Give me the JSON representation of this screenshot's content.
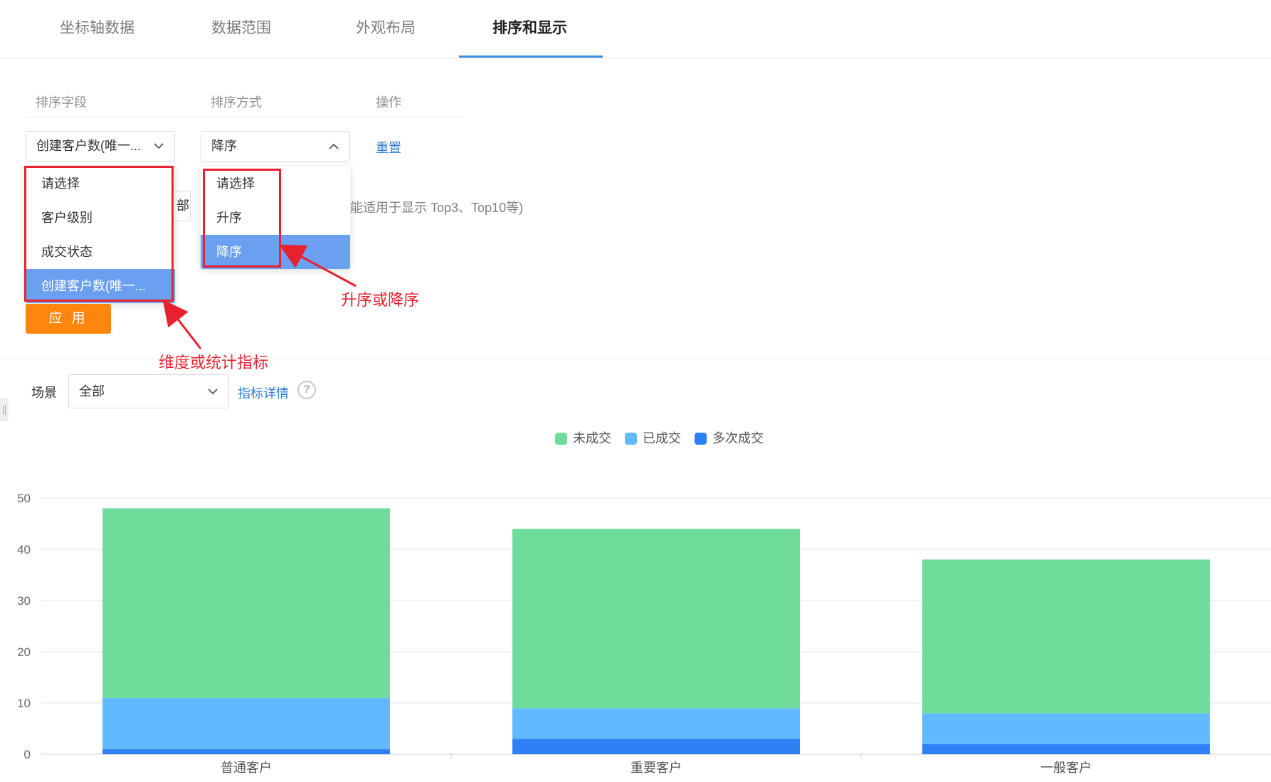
{
  "tabs": [
    {
      "label": "坐标轴数据"
    },
    {
      "label": "数据范围"
    },
    {
      "label": "外观布局"
    },
    {
      "label": "排序和显示"
    }
  ],
  "sort": {
    "header": {
      "field": "排序字段",
      "method": "排序方式",
      "action": "操作"
    },
    "field_value": "创建客户数(唯一...",
    "method_value": "降序",
    "reset_label": "重置"
  },
  "hidden_row": {
    "input_fragment": "部",
    "hint_fragment": "能适用于显示 Top3、Top10等)"
  },
  "field_menu": {
    "options": [
      "请选择",
      "客户级别",
      "成交状态",
      "创建客户数(唯一..."
    ],
    "selected_index": 3
  },
  "method_menu": {
    "options": [
      "请选择",
      "升序",
      "降序"
    ],
    "selected_index": 2
  },
  "annotations": {
    "field": "维度或统计指标",
    "method": "升序或降序"
  },
  "apply_label": "应 用",
  "scene": {
    "label": "场景",
    "value": "全部",
    "detail_link": "指标详情",
    "help": "?"
  },
  "colors": {
    "accent": "#3a8ee6",
    "apply": "#ff860d",
    "annotation": "#e8212e",
    "menu_selected": "#6b9ff0"
  },
  "chart_data": {
    "type": "bar",
    "stacked": true,
    "categories": [
      "普通客户",
      "重要客户",
      "一般客户"
    ],
    "series": [
      {
        "name": "多次成交",
        "color": "#2f7ff5",
        "values": [
          1,
          3,
          2
        ]
      },
      {
        "name": "已成交",
        "color": "#61b9ff",
        "values": [
          10,
          6,
          6
        ]
      },
      {
        "name": "未成交",
        "color": "#70dc9c",
        "values": [
          37,
          35,
          30
        ]
      }
    ],
    "legend_order": [
      "未成交",
      "已成交",
      "多次成交"
    ],
    "yticks": [
      0,
      10,
      20,
      30,
      40,
      50
    ],
    "ylim": [
      0,
      50
    ],
    "grid": true,
    "legend": "top-center"
  }
}
